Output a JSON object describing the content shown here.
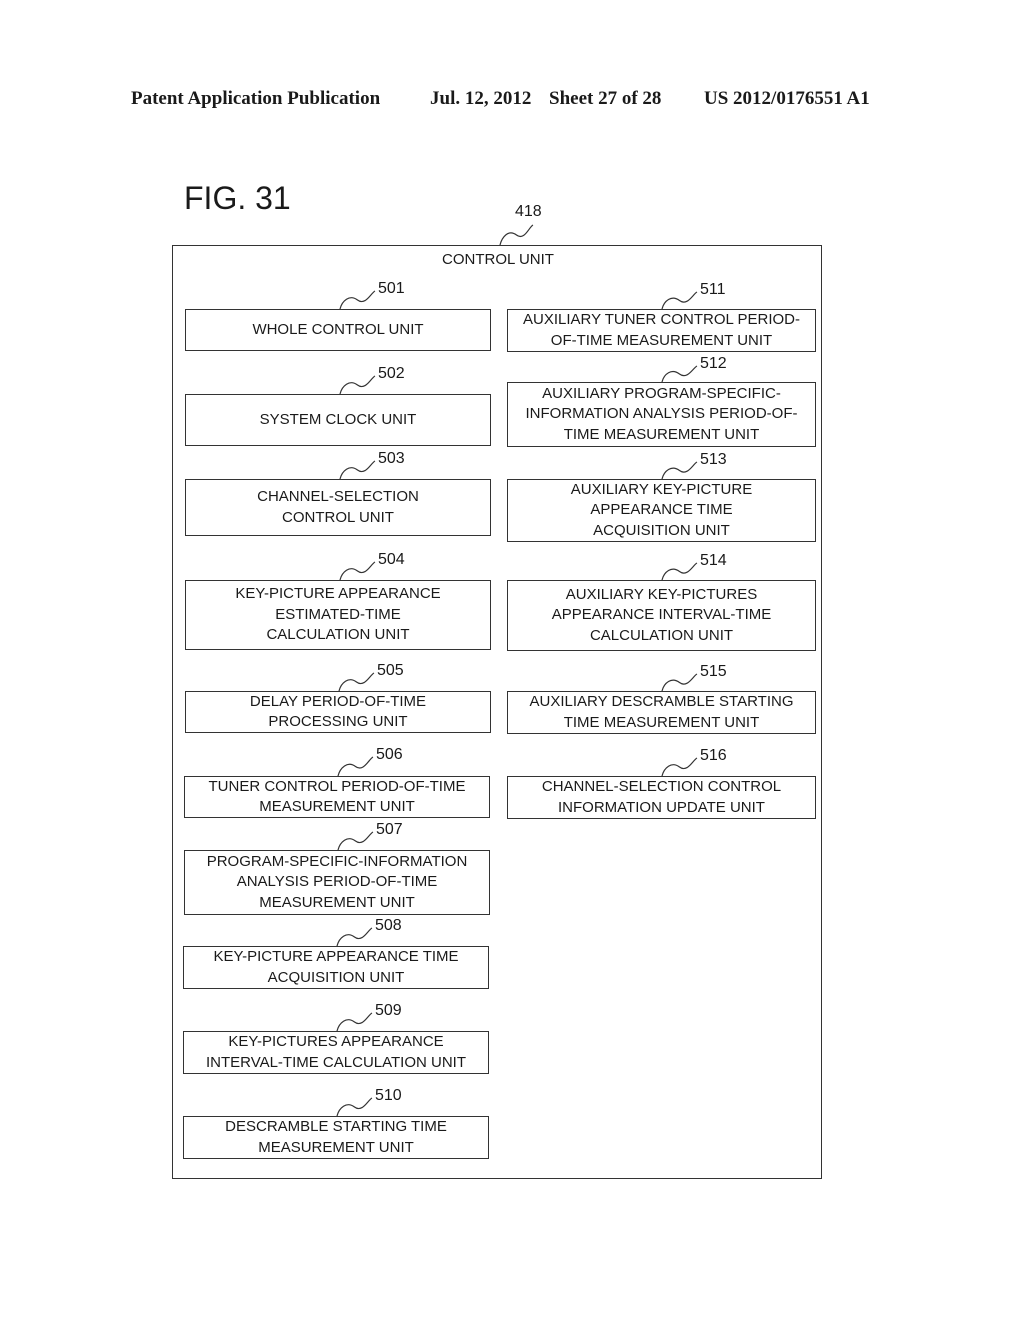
{
  "header": {
    "publication": "Patent Application Publication",
    "date": "Jul. 12, 2012",
    "sheet": "Sheet 27 of 28",
    "number": "US 2012/0176551 A1"
  },
  "figure": {
    "title": "FIG. 31",
    "outer": {
      "ref": "418",
      "label": "CONTROL UNIT"
    },
    "left_units": [
      {
        "ref": "501",
        "label": "WHOLE CONTROL UNIT"
      },
      {
        "ref": "502",
        "label": "SYSTEM CLOCK UNIT"
      },
      {
        "ref": "503",
        "label": "CHANNEL-SELECTION\nCONTROL UNIT"
      },
      {
        "ref": "504",
        "label": "KEY-PICTURE APPEARANCE\nESTIMATED-TIME\nCALCULATION UNIT"
      },
      {
        "ref": "505",
        "label": "DELAY PERIOD-OF-TIME\nPROCESSING UNIT"
      },
      {
        "ref": "506",
        "label": "TUNER CONTROL PERIOD-OF-TIME\nMEASUREMENT UNIT"
      },
      {
        "ref": "507",
        "label": "PROGRAM-SPECIFIC-INFORMATION\nANALYSIS PERIOD-OF-TIME\nMEASUREMENT UNIT"
      },
      {
        "ref": "508",
        "label": "KEY-PICTURE APPEARANCE TIME\nACQUISITION UNIT"
      },
      {
        "ref": "509",
        "label": "KEY-PICTURES APPEARANCE\nINTERVAL-TIME CALCULATION UNIT"
      },
      {
        "ref": "510",
        "label": "DESCRAMBLE STARTING TIME\nMEASUREMENT UNIT"
      }
    ],
    "right_units": [
      {
        "ref": "511",
        "label": "AUXILIARY TUNER CONTROL PERIOD-\nOF-TIME MEASUREMENT UNIT"
      },
      {
        "ref": "512",
        "label": "AUXILIARY PROGRAM-SPECIFIC-\nINFORMATION ANALYSIS PERIOD-OF-\nTIME MEASUREMENT UNIT"
      },
      {
        "ref": "513",
        "label": "AUXILIARY KEY-PICTURE\nAPPEARANCE TIME\nACQUISITION UNIT"
      },
      {
        "ref": "514",
        "label": "AUXILIARY KEY-PICTURES\nAPPEARANCE INTERVAL-TIME\nCALCULATION UNIT"
      },
      {
        "ref": "515",
        "label": "AUXILIARY DESCRAMBLE STARTING\nTIME MEASUREMENT UNIT"
      },
      {
        "ref": "516",
        "label": "CHANNEL-SELECTION CONTROL\nINFORMATION UPDATE UNIT"
      }
    ]
  }
}
